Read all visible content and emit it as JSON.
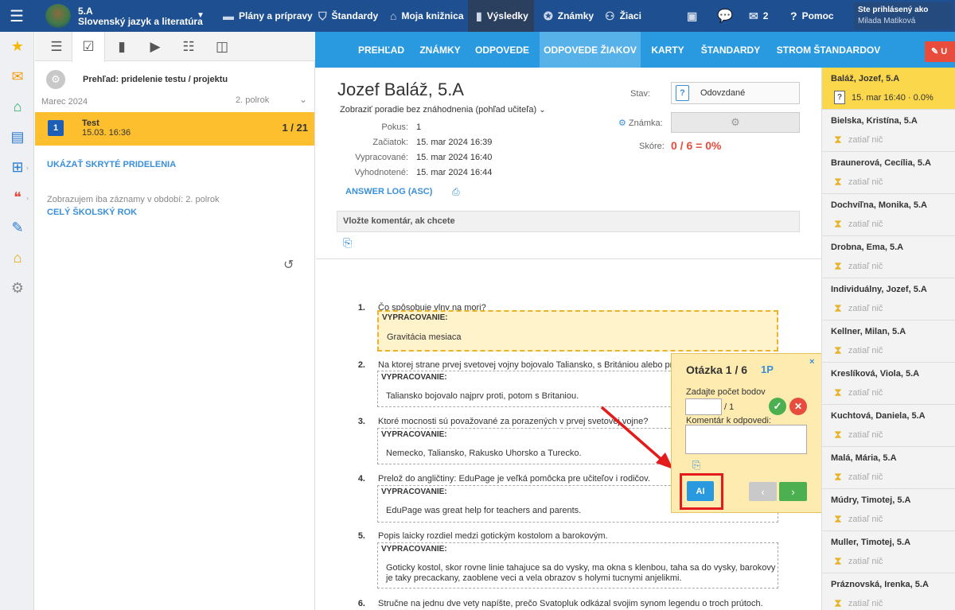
{
  "topbar": {
    "class_name": "5.A",
    "subject": "Slovenský jazyk a literatúra",
    "nav": [
      "Plány a prípravy",
      "Štandardy",
      "Moja knižnica",
      "Výsledky",
      "Známky",
      "Žiaci"
    ],
    "messages_count": "2",
    "help": "Pomoc",
    "logged_in_label": "Ste prihlásený ako",
    "user_name": "Milada Matiková"
  },
  "tabs": [
    "PREHĽAD",
    "ZNÁMKY",
    "ODPOVEDE",
    "ODPOVEDE ŽIAKOV",
    "KARTY",
    "ŠTANDARDY",
    "STROM ŠTANDARDOV"
  ],
  "red_button": "U",
  "left_panel": {
    "overview": "Prehľad: pridelenie testu / projektu",
    "month": "Marec 2024",
    "half": "2. polrok",
    "test": {
      "num": "1",
      "name": "Test",
      "date": "15.03. 16:36",
      "count": "1 / 21"
    },
    "show_hidden": "UKÁZAŤ SKRYTÉ PRIDELENIA",
    "period_note": "Zobrazujem iba záznamy v období: 2. polrok",
    "whole_year": "CELÝ ŠKOLSKÝ ROK"
  },
  "main": {
    "student_name": "Jozef Baláž, 5.A",
    "order_select": "Zobraziť poradie bez znáhodnenia (pohľad učiteľa)",
    "info": [
      {
        "label": "Pokus:",
        "value": "1"
      },
      {
        "label": "Začiatok:",
        "value": "15. mar 2024 16:39"
      },
      {
        "label": "Vypracované:",
        "value": "15. mar 2024 16:40"
      },
      {
        "label": "Vyhodnotené:",
        "value": "15. mar 2024 16:44"
      }
    ],
    "answer_log": "ANSWER LOG (ASC)",
    "state_label": "Stav:",
    "state_value": "Odovzdané",
    "grade_label": "Známka:",
    "score_label": "Skóre:",
    "score_value": "0 / 6 = 0%",
    "comment_placeholder": "Vložte komentár, ak chcete",
    "answer_label": "VYPRACOVANIE:",
    "questions": [
      {
        "num": "1.",
        "text": "Čo spôsobuje vlny na mori?",
        "answer": "Gravitácia mesiaca"
      },
      {
        "num": "2.",
        "text": "Na ktorej strane prvej svetovej vojny bojovalo Taliansko, s Britániou alebo pro",
        "answer": "Taliansko bojovalo najprv proti, potom s Britaniou."
      },
      {
        "num": "3.",
        "text": "Ktoré mocnosti sú považované za porazených v prvej svetovej vojne?",
        "answer": "Nemecko, Taliansko, Rakusko Uhorsko a Turecko."
      },
      {
        "num": "4.",
        "text": "Prelož do angličtiny: EduPage je veľká pomôcka pre učiteľov i rodičov.",
        "answer": "EduPage was great help for teachers and parents."
      },
      {
        "num": "5.",
        "text": "Popis laicky rozdiel medzi gotickým kostolom a barokovým.",
        "answer_l1": "Goticky kostol, skor rovne linie tahajuce sa do vysky, ma okna s klenbou, taha sa do vysky, barokovy",
        "answer_l2": "je taky precackany, zaoblene veci a vela obrazov s holymi tucnymi anjelikmi."
      },
      {
        "num": "6.",
        "text": "Stručne na jednu dve vety napíšte, prečo Svatopluk odkázal svojim synom legendu o troch prútoch."
      }
    ]
  },
  "popup": {
    "title": "Otázka 1 / 6",
    "points": "1P",
    "close": "×",
    "points_label": "Zadajte počet bodov",
    "max": "/ 1",
    "comment_label": "Komentár k odpovedi:",
    "ai_label": "AI",
    "prev": "‹",
    "next": "›"
  },
  "students": [
    {
      "name": "Baláž, Jozef, 5.A",
      "status": "15. mar 16:40 · 0.0%"
    },
    {
      "name": "Bielska, Kristína, 5.A",
      "status": "zatiaľ nič"
    },
    {
      "name": "Braunerová, Cecília, 5.A",
      "status": "zatiaľ nič"
    },
    {
      "name": "Dochvíľna, Monika, 5.A",
      "status": "zatiaľ nič"
    },
    {
      "name": "Drobna, Ema, 5.A",
      "status": "zatiaľ nič"
    },
    {
      "name": "Individuálny, Jozef, 5.A",
      "status": "zatiaľ nič"
    },
    {
      "name": "Kellner, Milan, 5.A",
      "status": "zatiaľ nič"
    },
    {
      "name": "Kreslíková, Viola, 5.A",
      "status": "zatiaľ nič"
    },
    {
      "name": "Kuchtová, Daniela, 5.A",
      "status": "zatiaľ nič"
    },
    {
      "name": "Malá, Mária, 5.A",
      "status": "zatiaľ nič"
    },
    {
      "name": "Múdry, Timotej, 5.A",
      "status": "zatiaľ nič"
    },
    {
      "name": "Muller, Timotej, 5.A",
      "status": "zatiaľ nič"
    },
    {
      "name": "Práznovská, Irenka, 5.A",
      "status": "zatiaľ nič"
    }
  ],
  "colors": {
    "topbar": "#1d4f91",
    "tabbar": "#2a9ae0",
    "highlight": "#fdbf2d",
    "score_red": "#e74c3c",
    "annotation_red": "#e31b1b"
  }
}
